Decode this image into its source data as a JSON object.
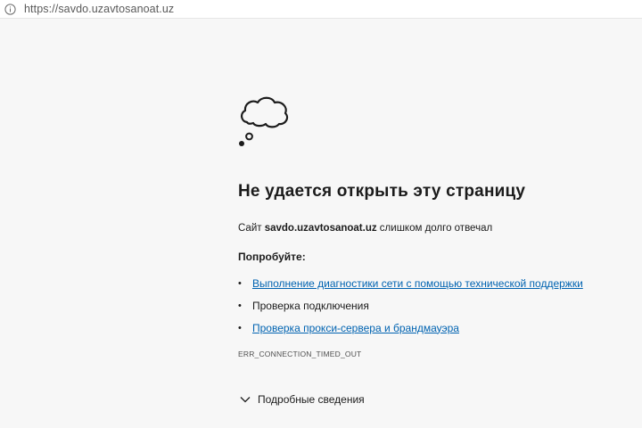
{
  "address_bar": {
    "url": "https://savdo.uzavtosanoat.uz",
    "icon": "info-icon"
  },
  "error": {
    "icon": "thought-cloud-icon",
    "title": "Не удается открыть эту страницу",
    "desc_prefix": "Сайт ",
    "site": "savdo.uzavtosanoat.uz",
    "desc_suffix": " слишком долго отвечал",
    "try_heading": "Попробуйте:",
    "suggestions": [
      "Выполнение диагностики сети с помощью технической поддержки",
      "Проверка подключения",
      "Проверка прокси-сервера и брандмауэра"
    ],
    "code": "ERR_CONNECTION_TIMED_OUT",
    "details_label": "Подробные сведения"
  },
  "colors": {
    "background": "#f7f7f7",
    "link": "#0063b1",
    "text": "#1b1b1b"
  }
}
